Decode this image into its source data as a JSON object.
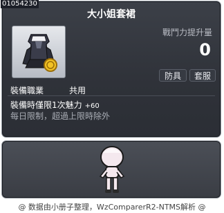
{
  "item_id": "01054230",
  "tooltip": {
    "title": "大小姐套裙",
    "stat_label": "戰鬥力提升量",
    "stat_value": "0",
    "tags": [
      "防具",
      "套服"
    ],
    "job_label": "裝備職業",
    "job_value": "共用",
    "limit_text": "裝備時僅限1次魅力",
    "limit_bonus": "+60",
    "daily_text": "每日限制，超過上限時除外"
  },
  "footer": "@ 数据由小册子整理，WzComparerR2-NTMS解析 @"
}
